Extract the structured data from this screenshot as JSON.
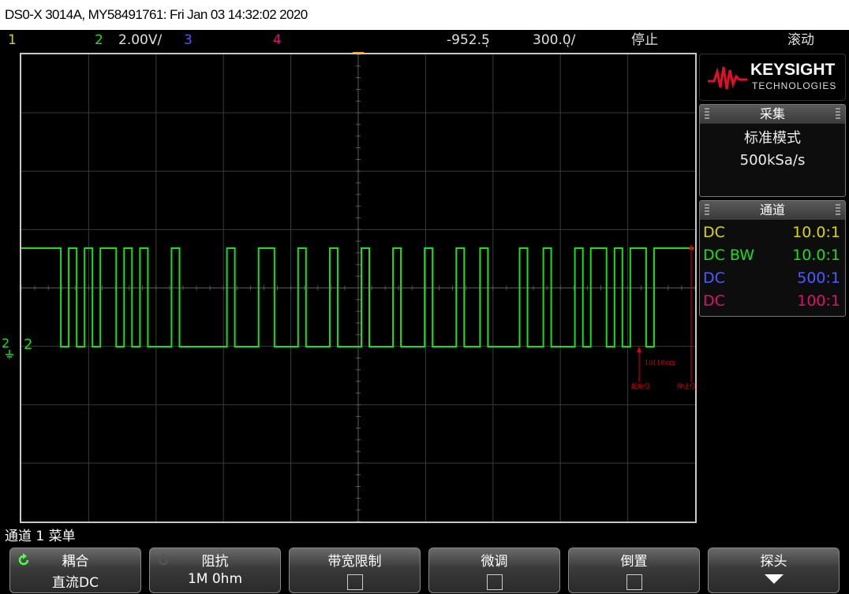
{
  "title": "DS0-X 3014A, MY58491761: Fri Jan 03 14:32:02 2020",
  "status": {
    "ch1": "1",
    "ch2": "2",
    "ch2_scale": "2.00V/",
    "ch3": "3",
    "ch4": "4",
    "time_offset": "-952.5ͅ",
    "time_scale": "300.0ͅ/",
    "run_state": "停止",
    "mode": "滚动"
  },
  "colors": {
    "ch1": "#d8d800",
    "ch2": "#18e018",
    "ch3": "#4a5cff",
    "ch4": "#e0106a",
    "trigger": "#ff9a00",
    "annot": "#e00000"
  },
  "trace_bits": "1111101010110101000100000010001100010001000100010001000100100001001000101101011011111",
  "channel_marker": "2",
  "ground_marker": "2",
  "annotations": {
    "bits": "10110xxx",
    "start": "起始位",
    "stop": "停止位"
  },
  "logo": {
    "brand": "KEYSIGHT",
    "sub": "TECHNOLOGIES"
  },
  "acquisition": {
    "header": "采集",
    "mode": "标准模式",
    "rate": "500kSa/s"
  },
  "channels_panel": {
    "header": "通道",
    "rows": [
      {
        "coupling": "DC",
        "ratio": "10.0:1"
      },
      {
        "coupling": "DC BW",
        "ratio": "10.0:1"
      },
      {
        "coupling": "DC",
        "ratio": "500:1"
      },
      {
        "coupling": "DC",
        "ratio": "100:1"
      }
    ]
  },
  "menu_title": "通道 1 菜单",
  "softkeys": [
    {
      "label": "耦合",
      "value": "直流DC",
      "icon": "cycle-icon"
    },
    {
      "label": "阻抗",
      "value": "1M 0hm",
      "icon": "cycle-icon"
    },
    {
      "label": "带宽限制",
      "value": "",
      "icon": "checkbox"
    },
    {
      "label": "微调",
      "value": "",
      "icon": "checkbox"
    },
    {
      "label": "倒置",
      "value": "",
      "icon": "checkbox"
    },
    {
      "label": "探头",
      "value": "",
      "icon": "down-arrow-icon"
    }
  ]
}
